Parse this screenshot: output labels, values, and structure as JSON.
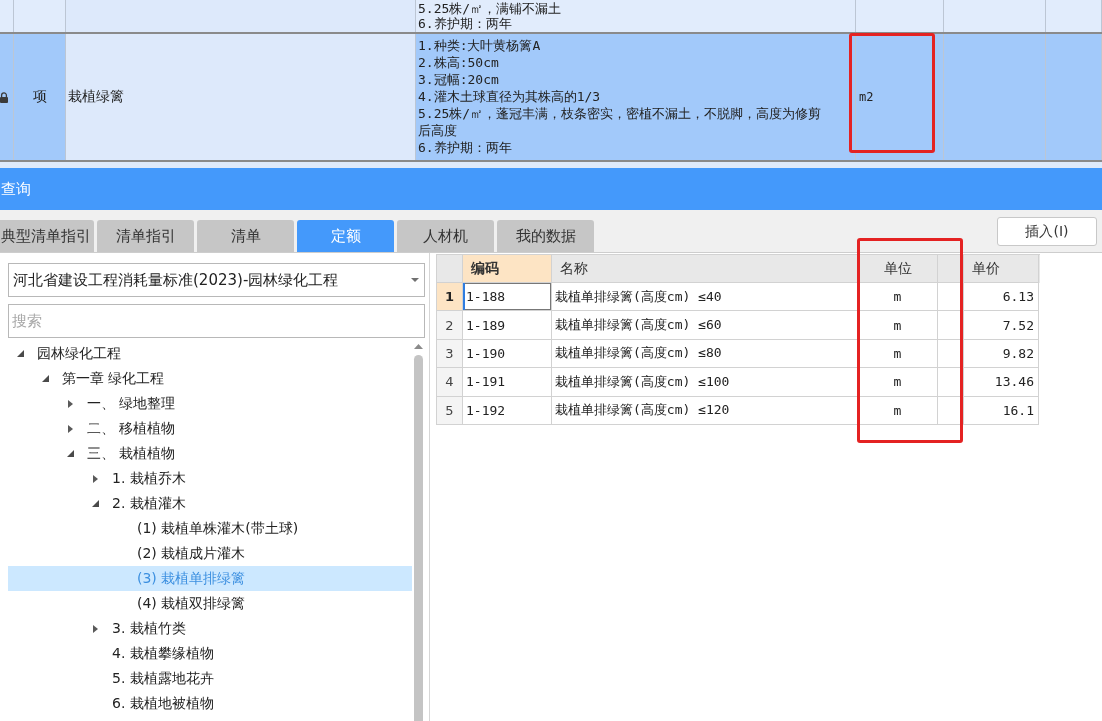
{
  "records_table": {
    "rows": [
      {
        "description": [
          "5.25株/㎡，满铺不漏土",
          "6.养护期：两年"
        ],
        "selected": false,
        "locked": false,
        "unit_highlighted": false
      },
      {
        "type": "项",
        "name": "栽植绿篱",
        "description": [
          "1.种类:大叶黄杨篱A",
          "2.株高:50cm",
          "3.冠幅:20cm",
          "4.灌木土球直径为其株高的1/3",
          "5.25株/㎡，蓬冠丰满，枝条密实，密植不漏土，不脱脚，高度为修剪后高度",
          "6.养护期：两年"
        ],
        "unit": "m2",
        "selected": true,
        "locked": true,
        "unit_highlighted": true
      }
    ]
  },
  "panel": {
    "title": "查询"
  },
  "tabs": [
    {
      "label": "典型清单指引",
      "selected": false
    },
    {
      "label": "清单指引",
      "selected": false
    },
    {
      "label": "清单",
      "selected": false
    },
    {
      "label": "定额",
      "selected": true
    },
    {
      "label": "人材机",
      "selected": false
    },
    {
      "label": "我的数据",
      "selected": false
    }
  ],
  "insert_button": "插入(I)",
  "library_dropdown": {
    "value": "河北省建设工程消耗量标准(2023)-园林绿化工程"
  },
  "search": {
    "placeholder": "搜索"
  },
  "tree": [
    {
      "label": "园林绿化工程",
      "kind": "branch",
      "expanded": true,
      "selected": false,
      "children": [
        {
          "label": "第一章 绿化工程",
          "kind": "branch",
          "expanded": true,
          "selected": false,
          "children": [
            {
              "label": "一、 绿地整理",
              "kind": "branch",
              "expanded": false,
              "selected": false
            },
            {
              "label": "二、 移植植物",
              "kind": "branch",
              "expanded": false,
              "selected": false
            },
            {
              "label": "三、 栽植植物",
              "kind": "branch",
              "expanded": true,
              "selected": false,
              "children": [
                {
                  "label": "1. 栽植乔木",
                  "kind": "branch",
                  "expanded": false,
                  "selected": false
                },
                {
                  "label": "2. 栽植灌木",
                  "kind": "branch",
                  "expanded": true,
                  "selected": false,
                  "children": [
                    {
                      "label": "(1) 栽植单株灌木(带土球)",
                      "kind": "leaf",
                      "selected": false
                    },
                    {
                      "label": "(2) 栽植成片灌木",
                      "kind": "leaf",
                      "selected": false
                    },
                    {
                      "label": "(3) 栽植单排绿篱",
                      "kind": "leaf",
                      "selected": true
                    },
                    {
                      "label": "(4) 栽植双排绿篱",
                      "kind": "leaf",
                      "selected": false
                    }
                  ]
                },
                {
                  "label": "3. 栽植竹类",
                  "kind": "branch",
                  "expanded": false,
                  "selected": false
                },
                {
                  "label": "4. 栽植攀缘植物",
                  "kind": "leaf",
                  "selected": false
                },
                {
                  "label": "5. 栽植露地花卉",
                  "kind": "leaf",
                  "selected": false
                },
                {
                  "label": "6. 栽植地被植物",
                  "kind": "leaf",
                  "selected": false
                }
              ]
            }
          ]
        }
      ]
    }
  ],
  "quota_table": {
    "columns": [
      {
        "label": "编码",
        "selected": true,
        "highlighted": false
      },
      {
        "label": "名称",
        "selected": false,
        "highlighted": false
      },
      {
        "label": "单位",
        "selected": false,
        "highlighted": true
      },
      {
        "selected": false,
        "highlighted": false
      },
      {
        "label": "单价",
        "selected": false,
        "highlighted": false
      }
    ],
    "rows": [
      {
        "number": "1",
        "code": "1-188",
        "name": "栽植单排绿篱(高度cm) ≤40",
        "unit": "m",
        "price": "6.13",
        "selected": true
      },
      {
        "number": "2",
        "code": "1-189",
        "name": "栽植单排绿篱(高度cm) ≤60",
        "unit": "m",
        "price": "7.52",
        "selected": false
      },
      {
        "number": "3",
        "code": "1-190",
        "name": "栽植单排绿篱(高度cm) ≤80",
        "unit": "m",
        "price": "9.82",
        "selected": false
      },
      {
        "number": "4",
        "code": "1-191",
        "name": "栽植单排绿篱(高度cm) ≤100",
        "unit": "m",
        "price": "13.46",
        "selected": false
      },
      {
        "number": "5",
        "code": "1-192",
        "name": "栽植单排绿篱(高度cm) ≤120",
        "unit": "m",
        "price": "16.1",
        "selected": false
      }
    ]
  }
}
